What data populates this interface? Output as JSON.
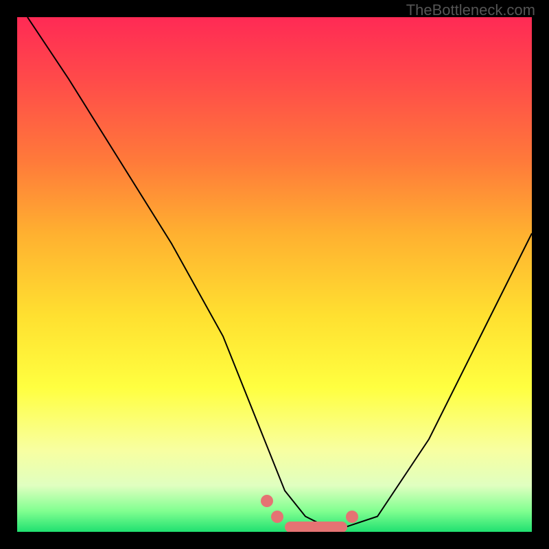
{
  "watermark": "TheBottleneck.com",
  "chart_data": {
    "type": "line",
    "title": "",
    "xlabel": "",
    "ylabel": "",
    "xlim": [
      0,
      100
    ],
    "ylim": [
      0,
      100
    ],
    "series": [
      {
        "name": "curve",
        "x": [
          2,
          10,
          20,
          30,
          40,
          48,
          52,
          56,
          60,
          64,
          70,
          80,
          90,
          100
        ],
        "y": [
          100,
          88,
          72,
          56,
          38,
          18,
          8,
          3,
          1,
          1,
          3,
          18,
          38,
          58
        ]
      }
    ],
    "markers": [
      {
        "x": 48.5,
        "y": 6
      },
      {
        "x": 50.5,
        "y": 3
      },
      {
        "x": 65,
        "y": 3
      }
    ],
    "flat_segment": {
      "x0": 53,
      "x1": 63,
      "y": 1
    }
  },
  "colors": {
    "marker": "#e57373",
    "curve": "#000000"
  }
}
